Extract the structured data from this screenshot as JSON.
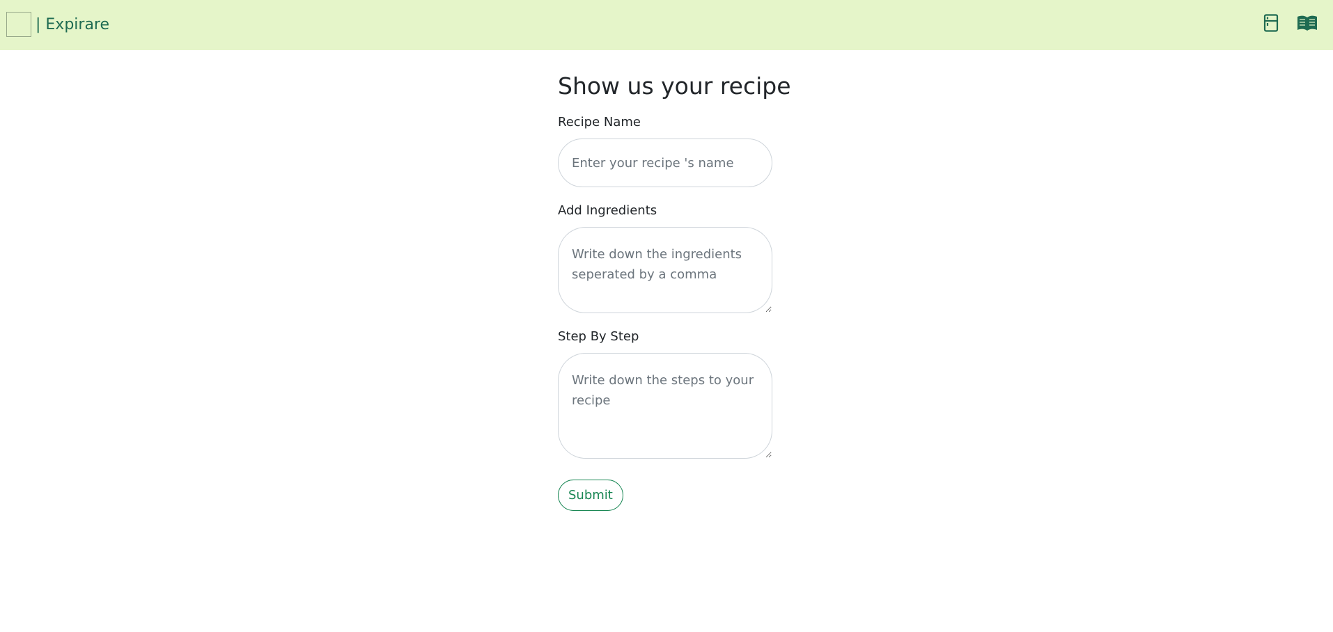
{
  "navbar": {
    "brand_text": "| Expirare",
    "icons": [
      "fridge-icon",
      "book-icon"
    ],
    "background": "#e5f5c9",
    "accent": "#1f6b52"
  },
  "form": {
    "title": "Show us your recipe",
    "recipe_name": {
      "label": "Recipe Name",
      "value": "",
      "placeholder": "Enter your recipe 's name"
    },
    "ingredients": {
      "label": "Add Ingredients",
      "value": "",
      "placeholder": "Write down the ingredients seperated by a comma"
    },
    "steps": {
      "label": "Step By Step",
      "value": "",
      "placeholder": "Write down the steps to your recipe"
    },
    "submit_label": "Submit",
    "submit_color": "#198754"
  }
}
